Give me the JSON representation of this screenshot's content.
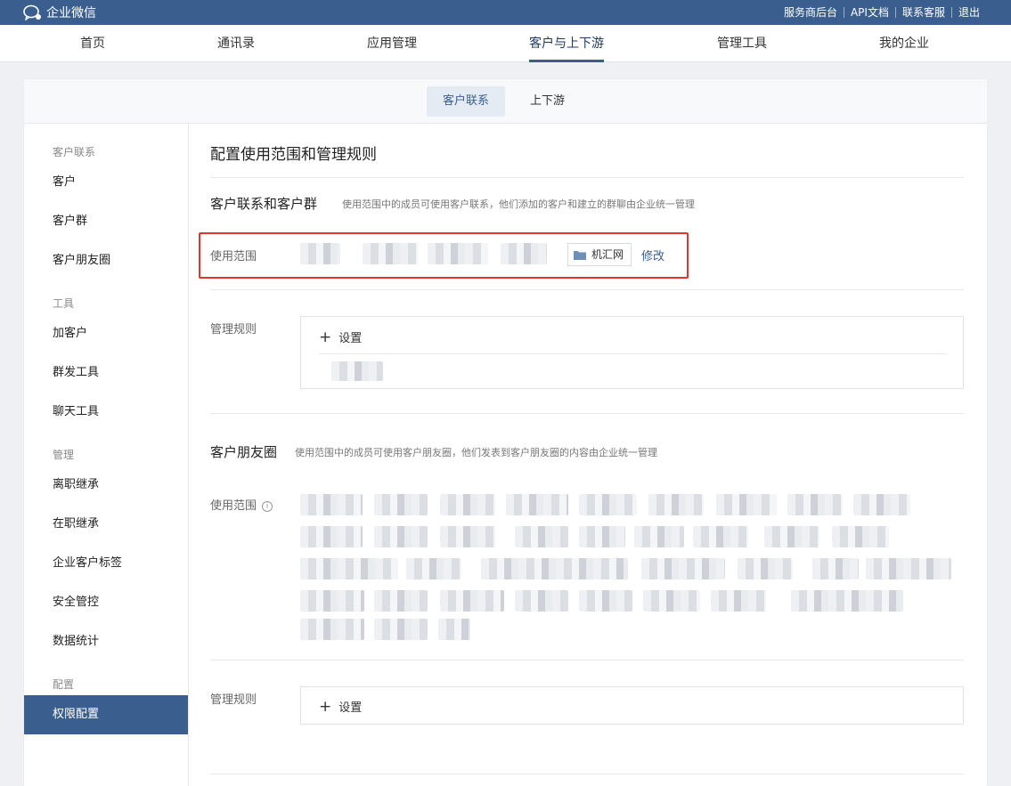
{
  "topbar": {
    "logo_text": "企业微信",
    "links": [
      "服务商后台",
      "API文档",
      "联系客服",
      "退出"
    ]
  },
  "nav": {
    "items": [
      "首页",
      "通讯录",
      "应用管理",
      "客户与上下游",
      "管理工具",
      "我的企业"
    ],
    "active_index": 3
  },
  "subtabs": {
    "items": [
      "客户联系",
      "上下游"
    ],
    "active_index": 0
  },
  "sidebar": {
    "groups": [
      {
        "title": "客户联系",
        "items": [
          "客户",
          "客户群",
          "客户朋友圈"
        ]
      },
      {
        "title": "工具",
        "items": [
          "加客户",
          "群发工具",
          "聊天工具"
        ]
      },
      {
        "title": "管理",
        "items": [
          "离职继承",
          "在职继承",
          "企业客户标签",
          "安全管控",
          "数据统计"
        ]
      },
      {
        "title": "配置",
        "items": [
          "权限配置"
        ]
      }
    ],
    "active_item": "权限配置"
  },
  "content": {
    "page_title": "配置使用范围和管理规则",
    "section1": {
      "title": "客户联系和客户群",
      "desc": "使用范围中的成员可使用客户联系，他们添加的客户和建立的群聊由企业统一管理",
      "scope_label": "使用范围",
      "scope_tag": "机汇网",
      "modify_label": "修改",
      "rule_label": "管理规则",
      "set_label": "设置"
    },
    "section2": {
      "title": "客户朋友圈",
      "desc": "使用范围中的成员可使用客户朋友圈，他们发表到客户朋友圈的内容由企业统一管理",
      "scope_label": "使用范围",
      "info_icon": "i",
      "rule_label": "管理规则",
      "set_label": "设置"
    }
  },
  "colors": {
    "brand": "#3a5f8e",
    "highlight_border": "#e4342e"
  }
}
